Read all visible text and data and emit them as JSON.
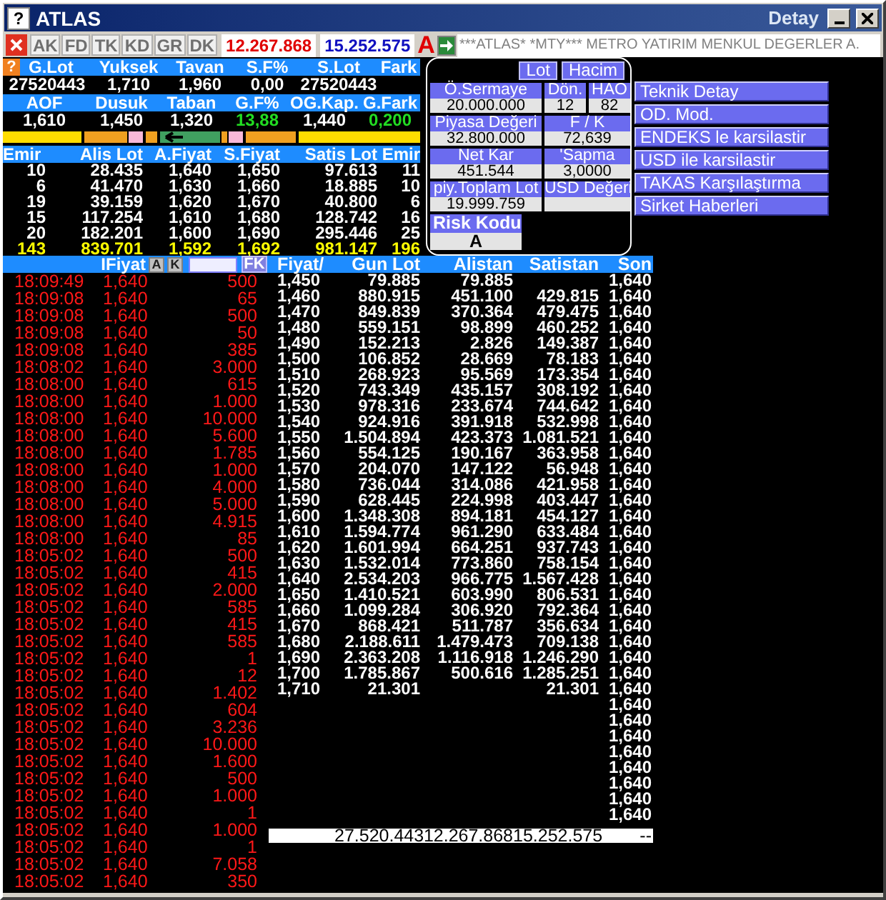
{
  "window": {
    "help_icon": "?",
    "title": "ATLAS",
    "caption_right": "Detay"
  },
  "toolbar": {
    "tabs": [
      {
        "label": "AK",
        "disabled": true
      },
      {
        "label": "FD",
        "disabled": true
      },
      {
        "label": "TK",
        "disabled": true
      },
      {
        "label": "KD",
        "disabled": true
      },
      {
        "label": "GR",
        "disabled": true
      },
      {
        "label": "DK",
        "disabled": true
      }
    ],
    "buy_total": "12.267.868",
    "sell_total": "15.252.575",
    "mode": "A",
    "ticker": "***ATLAS* *MTY*** METRO YATIRIM MENKUL DEGERLER A."
  },
  "summary": {
    "help_icon": "?",
    "groups": [
      {
        "headers": [
          "G.Lot",
          "Yuksek",
          "Tavan",
          "S.F%",
          "S.Lot",
          "Fark"
        ],
        "values": [
          {
            "text": "27520443",
            "up": false
          },
          {
            "text": "1,710",
            "up": false
          },
          {
            "text": "1,960",
            "up": false
          },
          {
            "text": "0,00",
            "up": false
          },
          {
            "text": "27520443",
            "up": false
          }
        ]
      },
      {
        "headers": [
          "AOF",
          "Dusuk",
          "Taban",
          "G.F%",
          "OG.Kap.",
          "G.Fark"
        ],
        "values": [
          {
            "text": "1,610",
            "up": false
          },
          {
            "text": "1,450",
            "up": false
          },
          {
            "text": "1,320",
            "up": false
          },
          {
            "text": "13,88",
            "up": true
          },
          {
            "text": "1,440",
            "up": false
          },
          {
            "text": "0,200",
            "up": true
          }
        ]
      }
    ]
  },
  "order_book": {
    "headers": [
      "Emir",
      "Alis Lot",
      "A.Fiyat",
      "S.Fiyat",
      "Satis Lot",
      "Emir"
    ],
    "rows": [
      {
        "kind": "level",
        "cells": [
          "10",
          "28.435",
          "1,640",
          "1,650",
          "97.613",
          "11"
        ]
      },
      {
        "kind": "level",
        "cells": [
          "6",
          "41.470",
          "1,630",
          "1,660",
          "18.885",
          "10"
        ]
      },
      {
        "kind": "level",
        "cells": [
          "19",
          "39.159",
          "1,620",
          "1,670",
          "40.800",
          "6"
        ]
      },
      {
        "kind": "level",
        "cells": [
          "15",
          "117.254",
          "1,610",
          "1,680",
          "128.742",
          "16"
        ]
      },
      {
        "kind": "level",
        "cells": [
          "20",
          "182.201",
          "1,600",
          "1,690",
          "295.446",
          "25"
        ]
      },
      {
        "kind": "total",
        "cells": [
          "143",
          "839.701",
          "1,592",
          "1,692",
          "981.147",
          "196"
        ]
      }
    ]
  },
  "fundamentals": {
    "view_buttons": [
      "Lot",
      "Hacim"
    ],
    "rows": [
      [
        {
          "label": "Ö.Sermaye",
          "value": "20.000.000"
        },
        {
          "label": "Dön.",
          "value": "12"
        },
        {
          "label": "HAO",
          "value": "82"
        }
      ],
      [
        {
          "label": "Piyasa Değeri",
          "value": "32.800.000"
        },
        {
          "label": "F / K",
          "value": "72,639"
        }
      ],
      [
        {
          "label": "Net Kar",
          "value": "451.544"
        },
        {
          "label": "'Sapma",
          "value": "3,0000"
        }
      ],
      [
        {
          "label": "piy.Toplam Lot",
          "value": "19.999.759"
        },
        {
          "label": "USD Değeri"
        }
      ]
    ],
    "risk": {
      "label": "Risk Kodu",
      "value": "A"
    }
  },
  "actions": [
    "Teknik Detay",
    "OD. Mod.",
    "ENDEKS le karsilastir",
    "USD ile karsilastir",
    "TAKAS Karşılaştırma",
    "Sirket Haberleri"
  ],
  "trades": {
    "header": "IFiyat",
    "buttons": [
      "A",
      "K"
    ],
    "filter_button": "FK",
    "rows": [
      {
        "time": "18:09:49",
        "price": "1,640",
        "lot": "500"
      },
      {
        "time": "18:09:08",
        "price": "1,640",
        "lot": "65"
      },
      {
        "time": "18:09:08",
        "price": "1,640",
        "lot": "500"
      },
      {
        "time": "18:09:08",
        "price": "1,640",
        "lot": "50"
      },
      {
        "time": "18:09:08",
        "price": "1,640",
        "lot": "385"
      },
      {
        "time": "18:08:02",
        "price": "1,640",
        "lot": "3.000"
      },
      {
        "time": "18:08:00",
        "price": "1,640",
        "lot": "615"
      },
      {
        "time": "18:08:00",
        "price": "1,640",
        "lot": "1.000"
      },
      {
        "time": "18:08:00",
        "price": "1,640",
        "lot": "10.000"
      },
      {
        "time": "18:08:00",
        "price": "1,640",
        "lot": "5.600"
      },
      {
        "time": "18:08:00",
        "price": "1,640",
        "lot": "1.785"
      },
      {
        "time": "18:08:00",
        "price": "1,640",
        "lot": "1.000"
      },
      {
        "time": "18:08:00",
        "price": "1,640",
        "lot": "4.000"
      },
      {
        "time": "18:08:00",
        "price": "1,640",
        "lot": "5.000"
      },
      {
        "time": "18:08:00",
        "price": "1,640",
        "lot": "4.915"
      },
      {
        "time": "18:08:00",
        "price": "1,640",
        "lot": "85"
      },
      {
        "time": "18:05:02",
        "price": "1,640",
        "lot": "500"
      },
      {
        "time": "18:05:02",
        "price": "1,640",
        "lot": "415"
      },
      {
        "time": "18:05:02",
        "price": "1,640",
        "lot": "2.000"
      },
      {
        "time": "18:05:02",
        "price": "1,640",
        "lot": "585"
      },
      {
        "time": "18:05:02",
        "price": "1,640",
        "lot": "415"
      },
      {
        "time": "18:05:02",
        "price": "1,640",
        "lot": "585"
      },
      {
        "time": "18:05:02",
        "price": "1,640",
        "lot": "1"
      },
      {
        "time": "18:05:02",
        "price": "1,640",
        "lot": "12"
      },
      {
        "time": "18:05:02",
        "price": "1,640",
        "lot": "1.402"
      },
      {
        "time": "18:05:02",
        "price": "1,640",
        "lot": "604"
      },
      {
        "time": "18:05:02",
        "price": "1,640",
        "lot": "3.236"
      },
      {
        "time": "18:05:02",
        "price": "1,640",
        "lot": "10.000"
      },
      {
        "time": "18:05:02",
        "price": "1,640",
        "lot": "1.600"
      },
      {
        "time": "18:05:02",
        "price": "1,640",
        "lot": "500"
      },
      {
        "time": "18:05:02",
        "price": "1,640",
        "lot": "1.000"
      },
      {
        "time": "18:05:02",
        "price": "1,640",
        "lot": "1"
      },
      {
        "time": "18:05:02",
        "price": "1,640",
        "lot": "1.000"
      },
      {
        "time": "18:05:02",
        "price": "1,640",
        "lot": "1"
      },
      {
        "time": "18:05:02",
        "price": "1,640",
        "lot": "7.058"
      },
      {
        "time": "18:05:02",
        "price": "1,640",
        "lot": "350"
      }
    ]
  },
  "price_table": {
    "headers": [
      "Fiyat/",
      "Gun Lot",
      "Alistan",
      "Satistan",
      "Son"
    ],
    "rows": [
      {
        "price": "1,450",
        "volume": "79.885",
        "bid": "79.885",
        "last": "1,640"
      },
      {
        "price": "1,460",
        "volume": "880.915",
        "bid": "451.100",
        "ask": "429.815",
        "last": "1,640"
      },
      {
        "price": "1,470",
        "volume": "849.839",
        "bid": "370.364",
        "ask": "479.475",
        "last": "1,640"
      },
      {
        "price": "1,480",
        "volume": "559.151",
        "bid": "98.899",
        "ask": "460.252",
        "last": "1,640"
      },
      {
        "price": "1,490",
        "volume": "152.213",
        "bid": "2.826",
        "ask": "149.387",
        "last": "1,640"
      },
      {
        "price": "1,500",
        "volume": "106.852",
        "bid": "28.669",
        "ask": "78.183",
        "last": "1,640"
      },
      {
        "price": "1,510",
        "volume": "268.923",
        "bid": "95.569",
        "ask": "173.354",
        "last": "1,640"
      },
      {
        "price": "1,520",
        "volume": "743.349",
        "bid": "435.157",
        "ask": "308.192",
        "last": "1,640"
      },
      {
        "price": "1,530",
        "volume": "978.316",
        "bid": "233.674",
        "ask": "744.642",
        "last": "1,640"
      },
      {
        "price": "1,540",
        "volume": "924.916",
        "bid": "391.918",
        "ask": "532.998",
        "last": "1,640"
      },
      {
        "price": "1,550",
        "volume": "1.504.894",
        "bid": "423.373",
        "ask": "1.081.521",
        "last": "1,640"
      },
      {
        "price": "1,560",
        "volume": "554.125",
        "bid": "190.167",
        "ask": "363.958",
        "last": "1,640"
      },
      {
        "price": "1,570",
        "volume": "204.070",
        "bid": "147.122",
        "ask": "56.948",
        "last": "1,640"
      },
      {
        "price": "1,580",
        "volume": "736.044",
        "bid": "314.086",
        "ask": "421.958",
        "last": "1,640"
      },
      {
        "price": "1,590",
        "volume": "628.445",
        "bid": "224.998",
        "ask": "403.447",
        "last": "1,640"
      },
      {
        "price": "1,600",
        "volume": "1.348.308",
        "bid": "894.181",
        "ask": "454.127",
        "last": "1,640"
      },
      {
        "price": "1,610",
        "volume": "1.594.774",
        "bid": "961.290",
        "ask": "633.484",
        "last": "1,640"
      },
      {
        "price": "1,620",
        "volume": "1.601.994",
        "bid": "664.251",
        "ask": "937.743",
        "last": "1,640"
      },
      {
        "price": "1,630",
        "volume": "1.532.014",
        "bid": "773.860",
        "ask": "758.154",
        "last": "1,640"
      },
      {
        "price": "1,640",
        "volume": "2.534.203",
        "bid": "966.775",
        "ask": "1.567.428",
        "last": "1,640"
      },
      {
        "price": "1,650",
        "volume": "1.410.521",
        "bid": "603.990",
        "ask": "806.531",
        "last": "1,640"
      },
      {
        "price": "1,660",
        "volume": "1.099.284",
        "bid": "306.920",
        "ask": "792.364",
        "last": "1,640"
      },
      {
        "price": "1,670",
        "volume": "868.421",
        "bid": "511.787",
        "ask": "356.634",
        "last": "1,640"
      },
      {
        "price": "1,680",
        "volume": "2.188.611",
        "bid": "1.479.473",
        "ask": "709.138",
        "last": "1,640"
      },
      {
        "price": "1,690",
        "volume": "2.363.208",
        "bid": "1.116.918",
        "ask": "1.246.290",
        "last": "1,640"
      },
      {
        "price": "1,700",
        "volume": "1.785.867",
        "bid": "500.616",
        "ask": "1.285.251",
        "last": "1,640"
      },
      {
        "price": "1,710",
        "volume": "21.301",
        "ask": "21.301",
        "last": "1,640"
      },
      {
        "last": "1,640"
      },
      {
        "last": "1,640"
      },
      {
        "last": "1,640"
      },
      {
        "last": "1,640"
      },
      {
        "last": "1,640"
      },
      {
        "last": "1,640"
      },
      {
        "last": "1,640"
      },
      {
        "last": "1,640"
      }
    ],
    "totals": {
      "volume": "27.520.443",
      "bid": "12.267.868",
      "ask": "15.252.575",
      "last": "--"
    }
  }
}
